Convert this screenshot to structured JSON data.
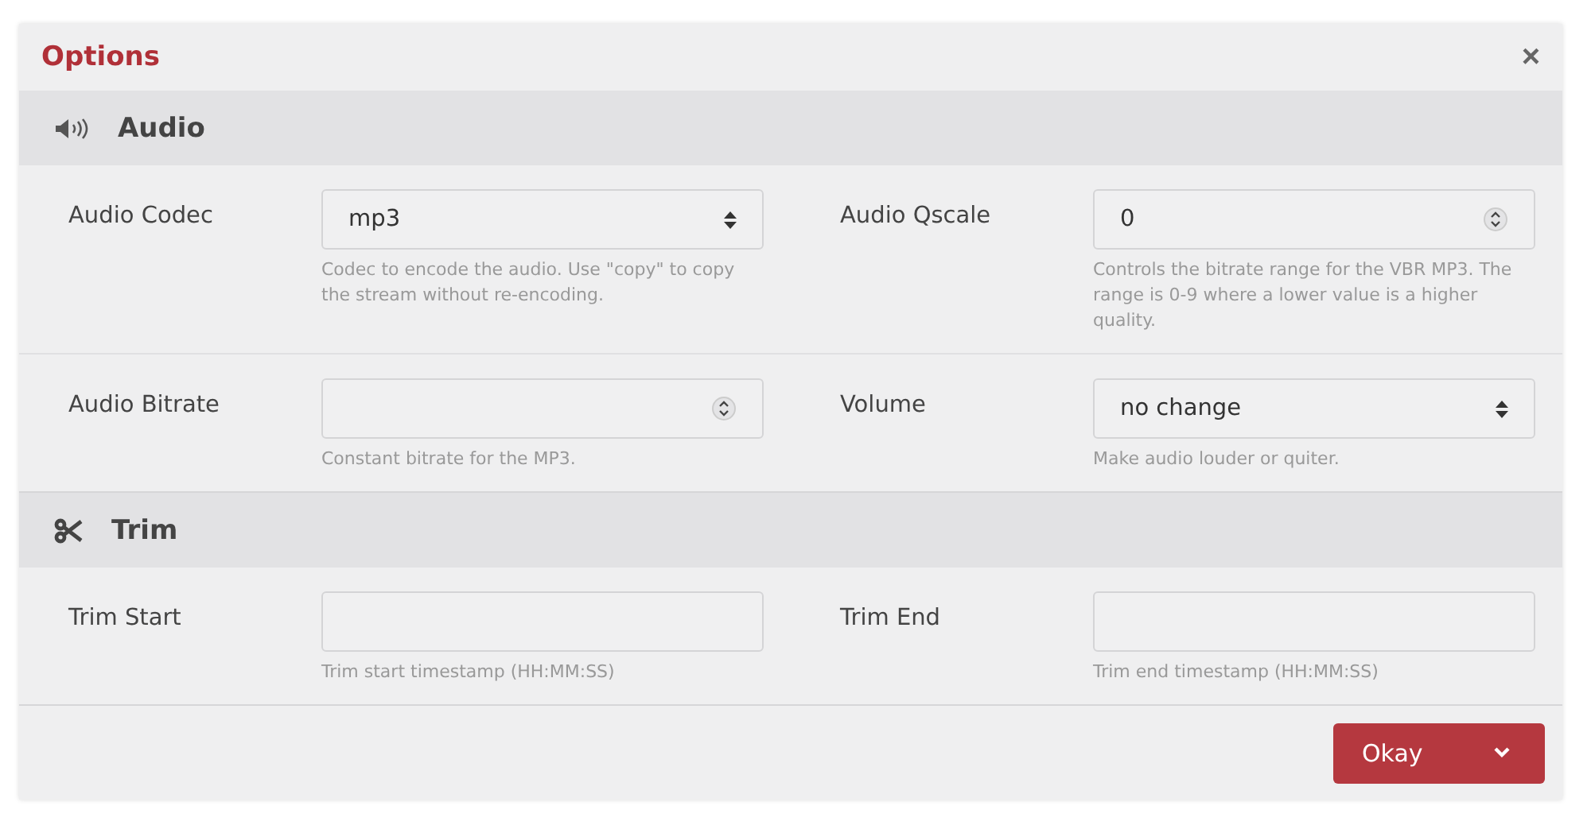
{
  "dialog": {
    "title": "Options",
    "close": "×"
  },
  "sections": [
    {
      "kind": "audio",
      "title": "Audio",
      "rows": [
        [
          {
            "label": "Audio Codec",
            "kind": "select",
            "value": "mp3",
            "help": "Codec to encode the audio. Use \"copy\" to copy the stream without re-encoding."
          },
          {
            "label": "Audio Qscale",
            "kind": "number",
            "value": "0",
            "help": "Controls the bitrate range for the VBR MP3. The range is 0-9 where a lower value is a higher quality."
          }
        ],
        [
          {
            "label": "Audio Bitrate",
            "kind": "number",
            "help": "Constant bitrate for the MP3."
          },
          {
            "label": "Volume",
            "kind": "select",
            "value": "no change",
            "help": "Make audio louder or quiter."
          }
        ]
      ]
    },
    {
      "kind": "trim",
      "title": "Trim",
      "rows": [
        [
          {
            "label": "Trim Start",
            "kind": "text",
            "help": "Trim start timestamp (HH:MM:SS)"
          },
          {
            "label": "Trim End",
            "kind": "text",
            "help": "Trim end timestamp (HH:MM:SS)"
          }
        ]
      ]
    }
  ],
  "footer": {
    "button": "Okay"
  }
}
